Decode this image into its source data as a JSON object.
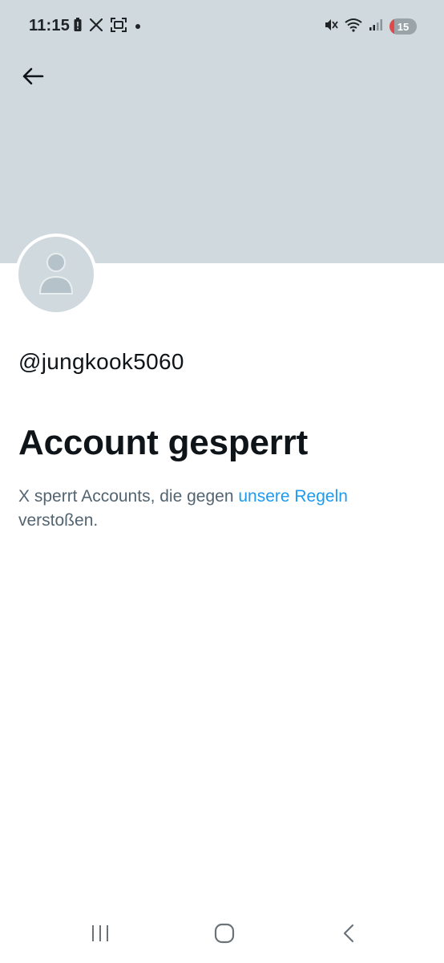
{
  "status_bar": {
    "time": "11:15",
    "battery_level": "15",
    "left_icons": [
      "battery-alert-icon",
      "x-app-icon",
      "screenshot-icon",
      "dot-icon"
    ],
    "right_icons": [
      "mute-icon",
      "wifi-icon",
      "signal-icon"
    ]
  },
  "header": {
    "back_icon": "arrow-left-icon"
  },
  "profile": {
    "handle": "@jungkook5060"
  },
  "suspended": {
    "title": "Account gesperrt",
    "description_prefix": "X sperrt Accounts, die gegen ",
    "rules_link": "unsere Regeln",
    "description_suffix": " verstoßen."
  },
  "navigation": {
    "buttons": [
      "recents-icon",
      "home-icon",
      "back-icon"
    ]
  },
  "colors": {
    "banner": "#cfd9de",
    "link": "#1d9bf0",
    "text_primary": "#0f1419",
    "text_secondary": "#536471"
  }
}
